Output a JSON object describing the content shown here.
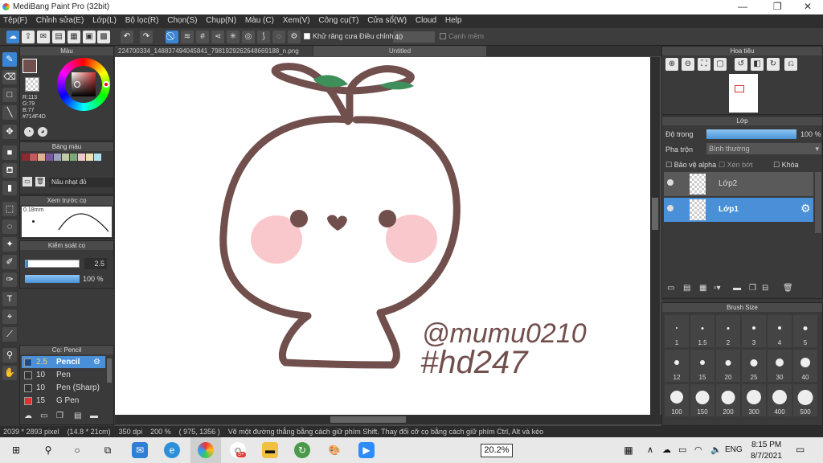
{
  "window": {
    "title": "MediBang Paint Pro (32bit)",
    "minimize": "—",
    "restore": "❐",
    "close": "✕"
  },
  "menu": [
    "Tệp(F)",
    "Chỉnh sửa(E)",
    "Lớp(L)",
    "Bộ lọc(R)",
    "Chọn(S)",
    "Chụp(N)",
    "Màu (C)",
    "Xem(V)",
    "Công cụ(T)",
    "Cửa sổ(W)",
    "Cloud",
    "Help"
  ],
  "toolbar": {
    "antialias_label": "Khử răng cưa",
    "adjust_label": "Điều chỉnh",
    "adjust_value": "40",
    "snap_label": "Cạnh mềm"
  },
  "color_panel": {
    "title": "Màu",
    "r": "R:113",
    "g": "G:79",
    "b": "B:77",
    "hex": "#714F4D",
    "primary": "#714f4d"
  },
  "palette_panel": {
    "title": "Bảng màu",
    "swatches": [
      "#8b2b2b",
      "#c45a5a",
      "#e0b090",
      "#7a5a9a",
      "#9aa0c0",
      "#c0c8a0",
      "#7aaa7a",
      "#f0c8c8",
      "#f0e0b0",
      "#b0e0f0"
    ],
    "item_label": "Nâu nhạt đỏ"
  },
  "preview_panel": {
    "title": "Xem trước cọ",
    "size": "0.18mm"
  },
  "brush_control": {
    "title": "Kiểm soát cọ",
    "size": "2.5",
    "opacity": "100 %"
  },
  "brush_panel": {
    "title": "Cọ: Pencil",
    "items": [
      {
        "size": "2.5",
        "name": "Pencil",
        "color": "#1a4a8a",
        "selected": true
      },
      {
        "size": "10",
        "name": "Pen",
        "color": "#333333",
        "selected": false
      },
      {
        "size": "10",
        "name": "Pen (Sharp)",
        "color": "#333333",
        "selected": false
      },
      {
        "size": "15",
        "name": "G Pen",
        "color": "#e03030",
        "selected": false
      }
    ]
  },
  "tabs": {
    "file": "224700334_148837494045841_7981929262648669188_n.png",
    "untitled": "Untitled"
  },
  "artwork": {
    "signature_line1": "@mumu0210",
    "signature_line2": "#hd247"
  },
  "navigator": {
    "title": "Hoa tiêu"
  },
  "layer_panel": {
    "title": "Lớp",
    "opacity_label": "Độ trong",
    "opacity_value": "100 %",
    "blend_label": "Pha trộn",
    "blend_value": "Bình thường",
    "alpha_label": "Bảo vệ alpha",
    "clip_label": "Xén bớt",
    "lock_label": "Khóa",
    "layers": [
      "Lớp2",
      "Lớp1"
    ]
  },
  "brush_size": {
    "title": "Brush Size",
    "sizes": [
      "1",
      "1.5",
      "2",
      "3",
      "4",
      "5",
      "12",
      "15",
      "20",
      "25",
      "30",
      "40",
      "100",
      "150",
      "200",
      "300",
      "400",
      "500"
    ]
  },
  "status": {
    "dimensions": "2039 * 2893 pixel",
    "physical": "(14.8 * 21cm)",
    "dpi": "350 dpi",
    "zoom": "200 %",
    "coords": "( 975, 1356 )",
    "hint": "Vẽ một đường thẳng bằng cách giữ phím Shift. Thay đổi cỡ cọ bằng cách giữ phím Ctrl, Alt và kéo"
  },
  "taskbar": {
    "zoom_popup": "20.2%",
    "lang": "ENG",
    "time": "8:15 PM",
    "date": "8/7/2021",
    "badge": "5+"
  }
}
